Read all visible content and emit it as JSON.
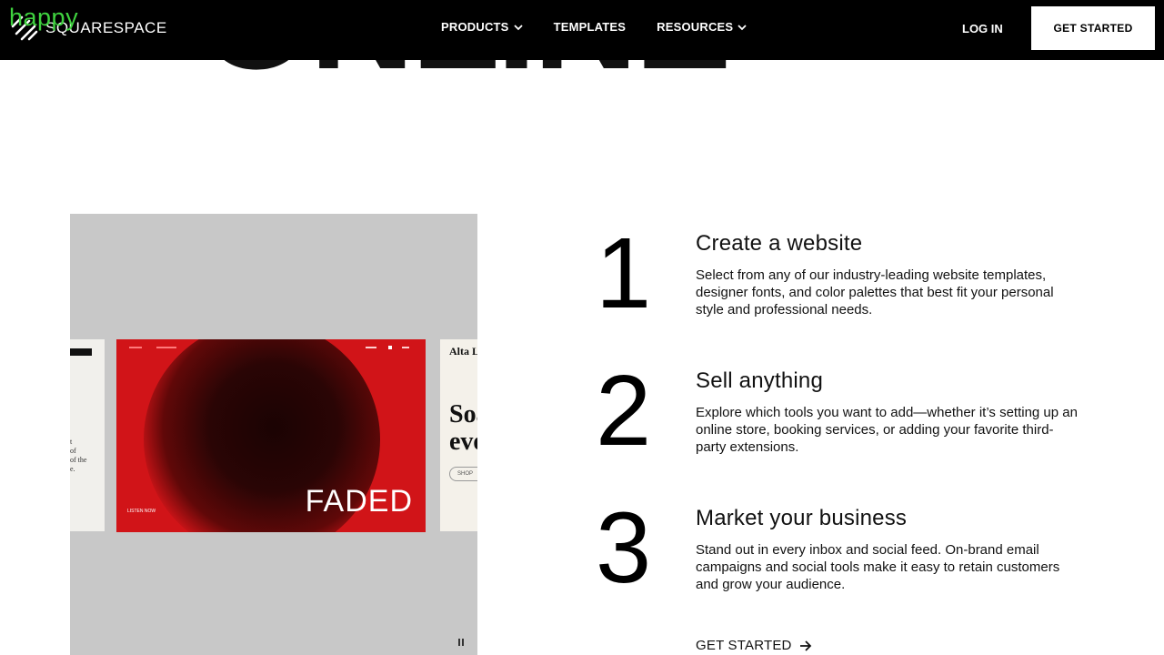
{
  "overlay": {
    "watermark": "happy"
  },
  "nav": {
    "logo_text": "SQUARESPACE",
    "menu": [
      {
        "label": "PRODUCTS",
        "has_dropdown": true
      },
      {
        "label": "TEMPLATES",
        "has_dropdown": false
      },
      {
        "label": "RESOURCES",
        "has_dropdown": true
      }
    ],
    "login": "LOG IN",
    "get_started": "GET STARTED"
  },
  "hero": {
    "headline_fragment": "ONLINE"
  },
  "media": {
    "left_card_text": "t\nof\nof the\ne.",
    "main_card_word": "FADED",
    "main_card_small": "LISTEN NOW",
    "right_card_title": "Alta Lo",
    "right_card_headline": "Soa\neve",
    "right_card_button": "SHOP",
    "pause_icon": "pause-icon"
  },
  "steps": [
    {
      "number": "1",
      "title": "Create a website",
      "description": "Select from any of our industry-leading website templates, designer fonts, and color palettes that best fit your personal style and professional needs."
    },
    {
      "number": "2",
      "title": "Sell anything",
      "description": "Explore which tools you want to add—whether it’s setting up an online store, booking services, or adding your favorite third-party extensions."
    },
    {
      "number": "3",
      "title": "Market your business",
      "description": "Stand out in every inbox and social feed. On-brand email campaigns and social tools make it easy to retain customers and grow your audience."
    }
  ],
  "cta": {
    "label": "GET STARTED"
  },
  "colors": {
    "nav_bg": "#000000",
    "accent_red": "#d11418",
    "media_bg": "#c8c8c8",
    "watermark": "#3fd23f"
  }
}
